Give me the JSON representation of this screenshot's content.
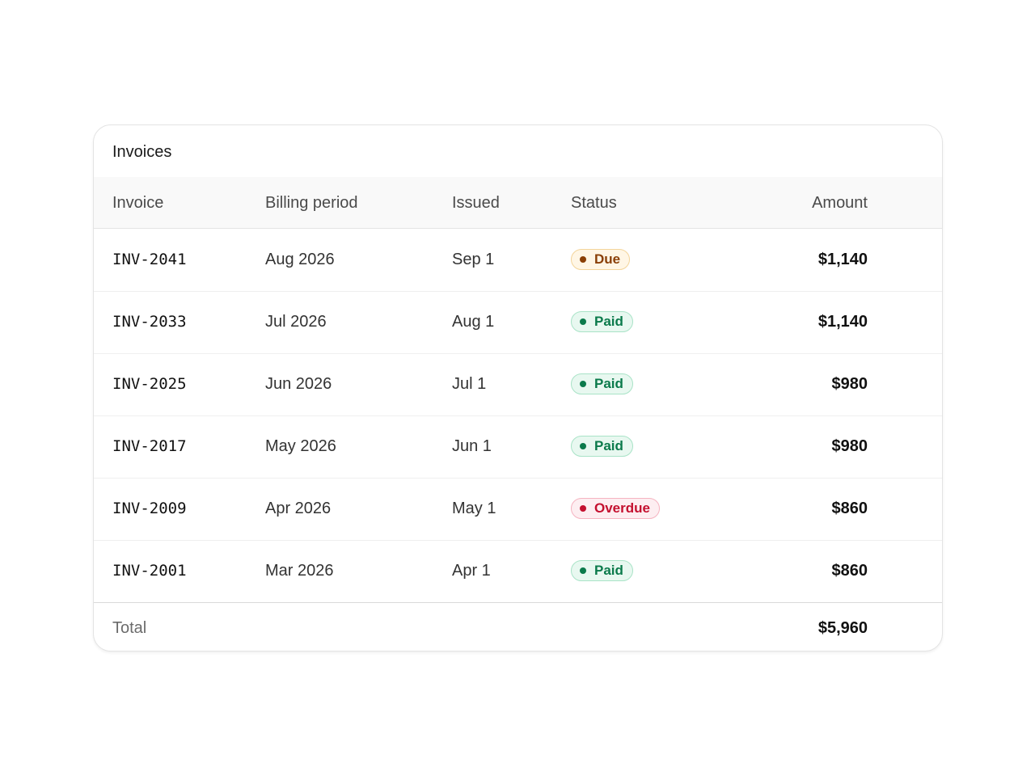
{
  "card": {
    "title": "Invoices"
  },
  "columns": {
    "invoice": "Invoice",
    "billing_period": "Billing period",
    "issued": "Issued",
    "status": "Status",
    "amount": "Amount"
  },
  "rows": [
    {
      "invoice": "INV-2041",
      "billing_period": "Aug 2026",
      "issued": "Sep 1",
      "status": "Due",
      "amount": "$1,140"
    },
    {
      "invoice": "INV-2033",
      "billing_period": "Jul 2026",
      "issued": "Aug 1",
      "status": "Paid",
      "amount": "$1,140"
    },
    {
      "invoice": "INV-2025",
      "billing_period": "Jun 2026",
      "issued": "Jul 1",
      "status": "Paid",
      "amount": "$980"
    },
    {
      "invoice": "INV-2017",
      "billing_period": "May 2026",
      "issued": "Jun 1",
      "status": "Paid",
      "amount": "$980"
    },
    {
      "invoice": "INV-2009",
      "billing_period": "Apr 2026",
      "issued": "May 1",
      "status": "Overdue",
      "amount": "$860"
    },
    {
      "invoice": "INV-2001",
      "billing_period": "Mar 2026",
      "issued": "Apr 1",
      "status": "Paid",
      "amount": "$860"
    }
  ],
  "footer": {
    "label": "Total",
    "value": "$5,960"
  },
  "status_colors": {
    "Due": "#8a3f06",
    "Paid": "#0b7a4b",
    "Overdue": "#c4102f"
  }
}
